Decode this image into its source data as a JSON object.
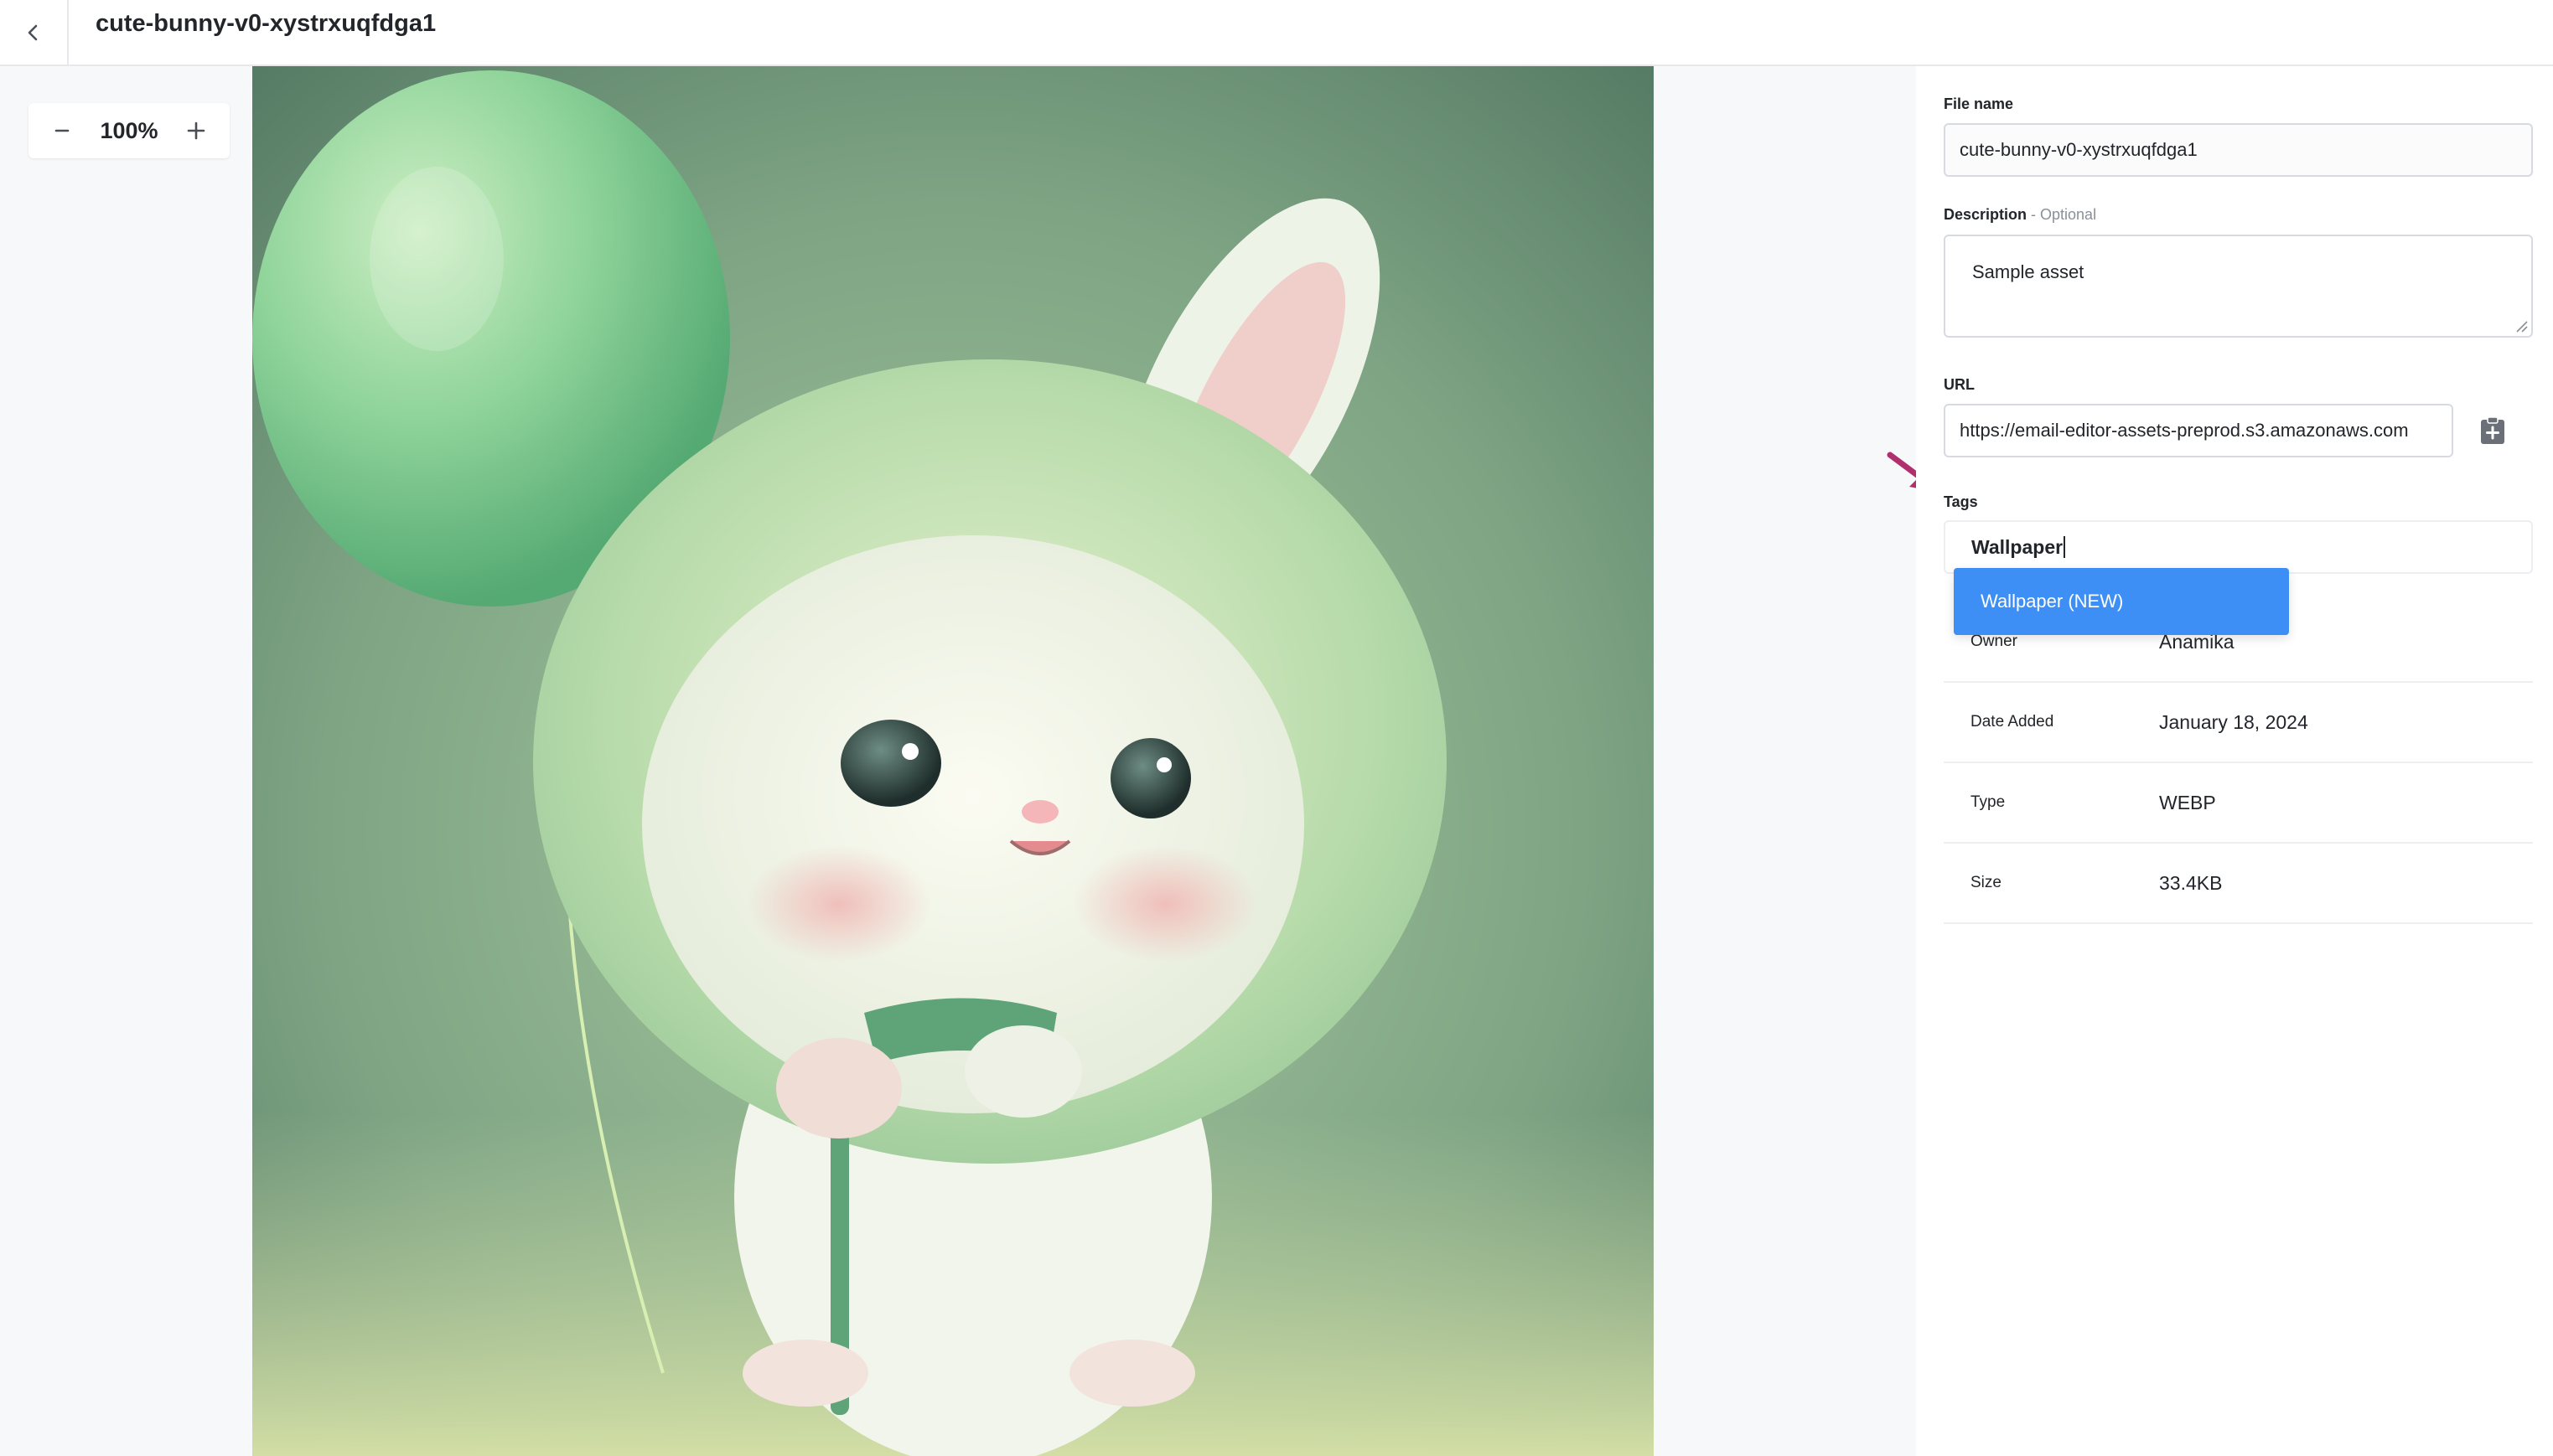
{
  "header": {
    "title": "cute-bunny-v0-xystrxuqfdga1"
  },
  "icons": {
    "back": "chevron-left-icon",
    "zoom_out": "minus-icon",
    "zoom_in": "plus-icon",
    "copy": "clipboard-plus-icon",
    "arrow": "annotation-arrow-icon"
  },
  "zoom": {
    "level": "100%"
  },
  "panel": {
    "file_name": {
      "label": "File name",
      "value": "cute-bunny-v0-xystrxuqfdga1"
    },
    "description": {
      "label": "Description",
      "optional": " - Optional",
      "value": "Sample asset"
    },
    "url": {
      "label": "URL",
      "value": "https://email-editor-assets-preprod.s3.amazonaws.com"
    },
    "tags": {
      "label": "Tags",
      "value": "Wallpaper",
      "suggestion": "Wallpaper (NEW)"
    },
    "meta": [
      {
        "key": "Owner",
        "value": "Anamika"
      },
      {
        "key": "Date Added",
        "value": "January 18, 2024"
      },
      {
        "key": "Type",
        "value": "WEBP"
      },
      {
        "key": "Size",
        "value": "33.4KB"
      }
    ]
  },
  "colors": {
    "accent": "#3d8ff5",
    "arrow": "#b0306e",
    "border": "#d7dadf"
  }
}
